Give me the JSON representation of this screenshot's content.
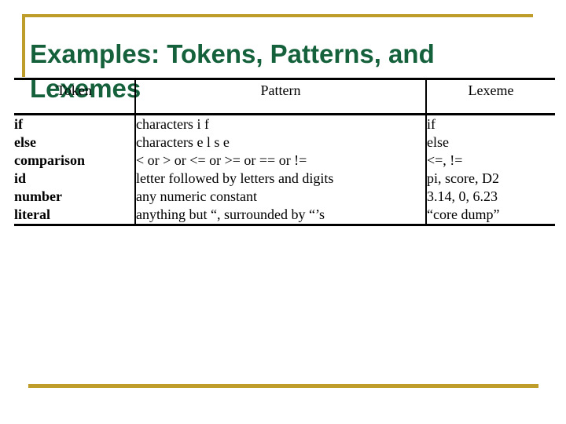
{
  "slide": {
    "title": "Examples: Tokens, Patterns, and Lexemes",
    "title_color": "#14613c",
    "accent_color": "#bf9d2b",
    "rule_color": "#000000"
  },
  "table": {
    "headers": {
      "token": "Token",
      "pattern": "Pattern",
      "lexeme": "Lexeme"
    },
    "rows": [
      {
        "token": "if",
        "pattern": "characters i  f",
        "lexeme": "if"
      },
      {
        "token": "else",
        "pattern": "characters e  l  s  e",
        "lexeme": "else"
      },
      {
        "token": "comparison",
        "pattern": "< or > or <= or >= or == or !=",
        "lexeme": "<=, !="
      },
      {
        "token": "id",
        "pattern": "letter followed by letters and digits",
        "lexeme": "pi, score, D2"
      },
      {
        "token": "number",
        "pattern": "any numeric constant",
        "lexeme": "3.14, 0, 6.23"
      },
      {
        "token": "literal",
        "pattern": "anything but “, surrounded by “’s",
        "lexeme": "“core dump”"
      }
    ]
  }
}
